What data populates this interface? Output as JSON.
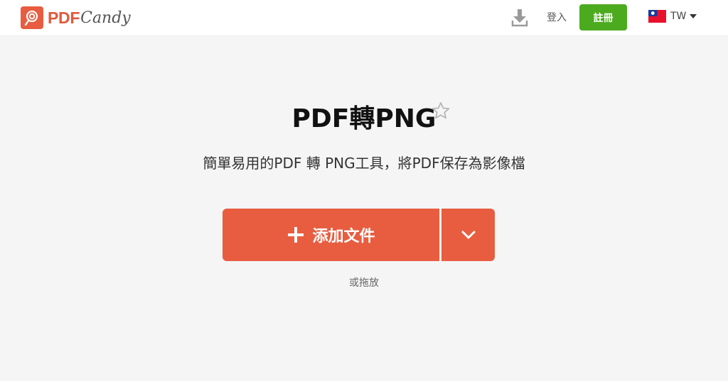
{
  "header": {
    "logo_pdf": "PDF",
    "logo_candy": "Candy",
    "login_label": "登入",
    "register_label": "註冊",
    "lang_code": "TW",
    "download_icon": "download-icon",
    "flag_icon": "taiwan-flag-icon"
  },
  "main": {
    "title": "PDF轉PNG",
    "favorite_icon": "star-outline-icon",
    "subtitle": "簡單易用的PDF 轉 PNG工具，將PDF保存為影像檔",
    "add_button_label": "添加文件",
    "more_icon": "chevron-down-icon",
    "drop_hint": "或拖放"
  },
  "colors": {
    "accent": "#e85d40",
    "register": "#4caa1e",
    "background": "#f5f5f5"
  }
}
